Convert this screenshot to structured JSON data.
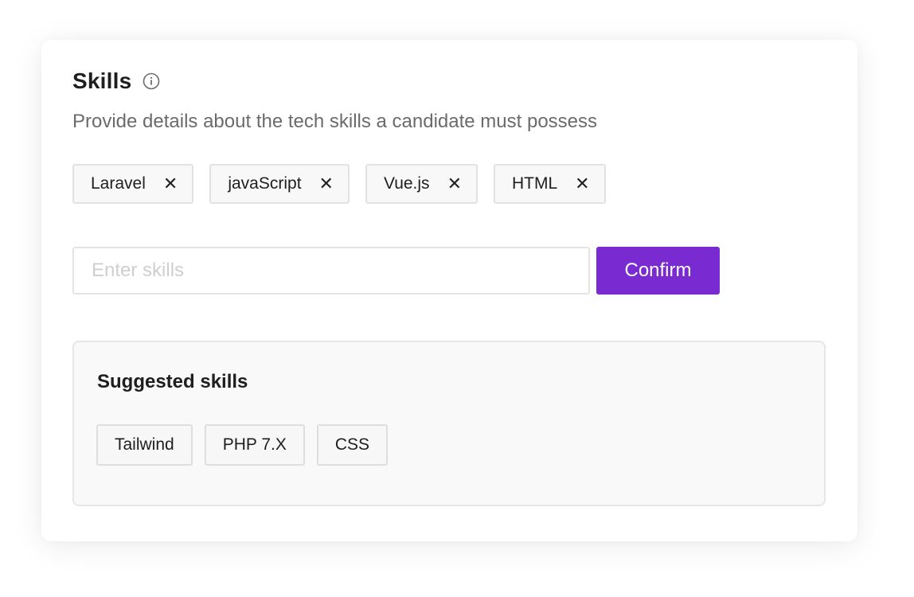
{
  "header": {
    "title": "Skills",
    "info_icon": "info-circle-icon",
    "subtitle": "Provide details about the tech skills a candidate must possess"
  },
  "selected_skills": [
    {
      "label": "Laravel",
      "remove_icon": "close-icon"
    },
    {
      "label": "javaScript",
      "remove_icon": "close-icon"
    },
    {
      "label": "Vue.js",
      "remove_icon": "close-icon"
    },
    {
      "label": "HTML",
      "remove_icon": "close-icon"
    }
  ],
  "input": {
    "value": "",
    "placeholder": "Enter skills"
  },
  "confirm_label": "Confirm",
  "suggested": {
    "title": "Suggested skills",
    "items": [
      "Tailwind",
      "PHP 7.X",
      "CSS"
    ]
  },
  "colors": {
    "accent": "#7a2ad1"
  }
}
